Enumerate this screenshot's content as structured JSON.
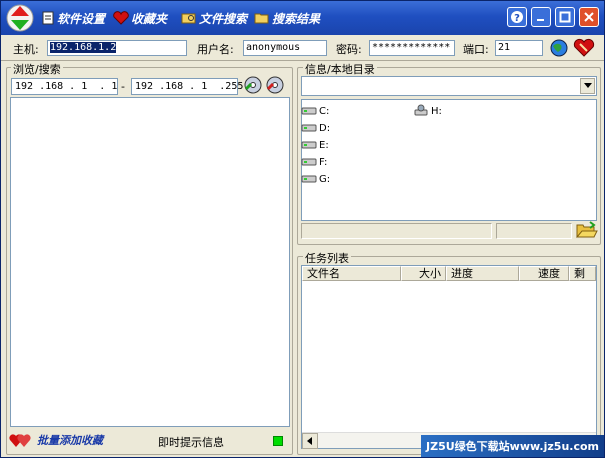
{
  "menu": {
    "settings": "软件设置",
    "favorites": "收藏夹",
    "file_search": "文件搜索",
    "search_results": "搜索结果"
  },
  "connection": {
    "host_label": "主机:",
    "host_value": "192.168.1.2",
    "user_label": "用户名:",
    "user_value": "anonymous",
    "password_label": "密码:",
    "password_value": "*************",
    "port_label": "端口:",
    "port_value": "21"
  },
  "browse": {
    "title": "浏览/搜索",
    "ip_start": "192 .168 . 1  . 1",
    "ip_separator": "-",
    "ip_end": "192 .168 . 1  .255",
    "batch_add": "批量添加收藏",
    "hint": "即时提示信息"
  },
  "local": {
    "title": "信息/本地目录",
    "drives": [
      "C:",
      "D:",
      "E:",
      "F:",
      "G:"
    ],
    "network_drive": "H:"
  },
  "tasks": {
    "title": "任务列表",
    "columns": [
      "文件名",
      "大小",
      "进度",
      "速度",
      "剩"
    ]
  },
  "watermark": "JZ5U绿色下载站www.jz5u.com",
  "colors": {
    "titlebar": "#1f4fc0",
    "status_green": "#00dd00"
  }
}
